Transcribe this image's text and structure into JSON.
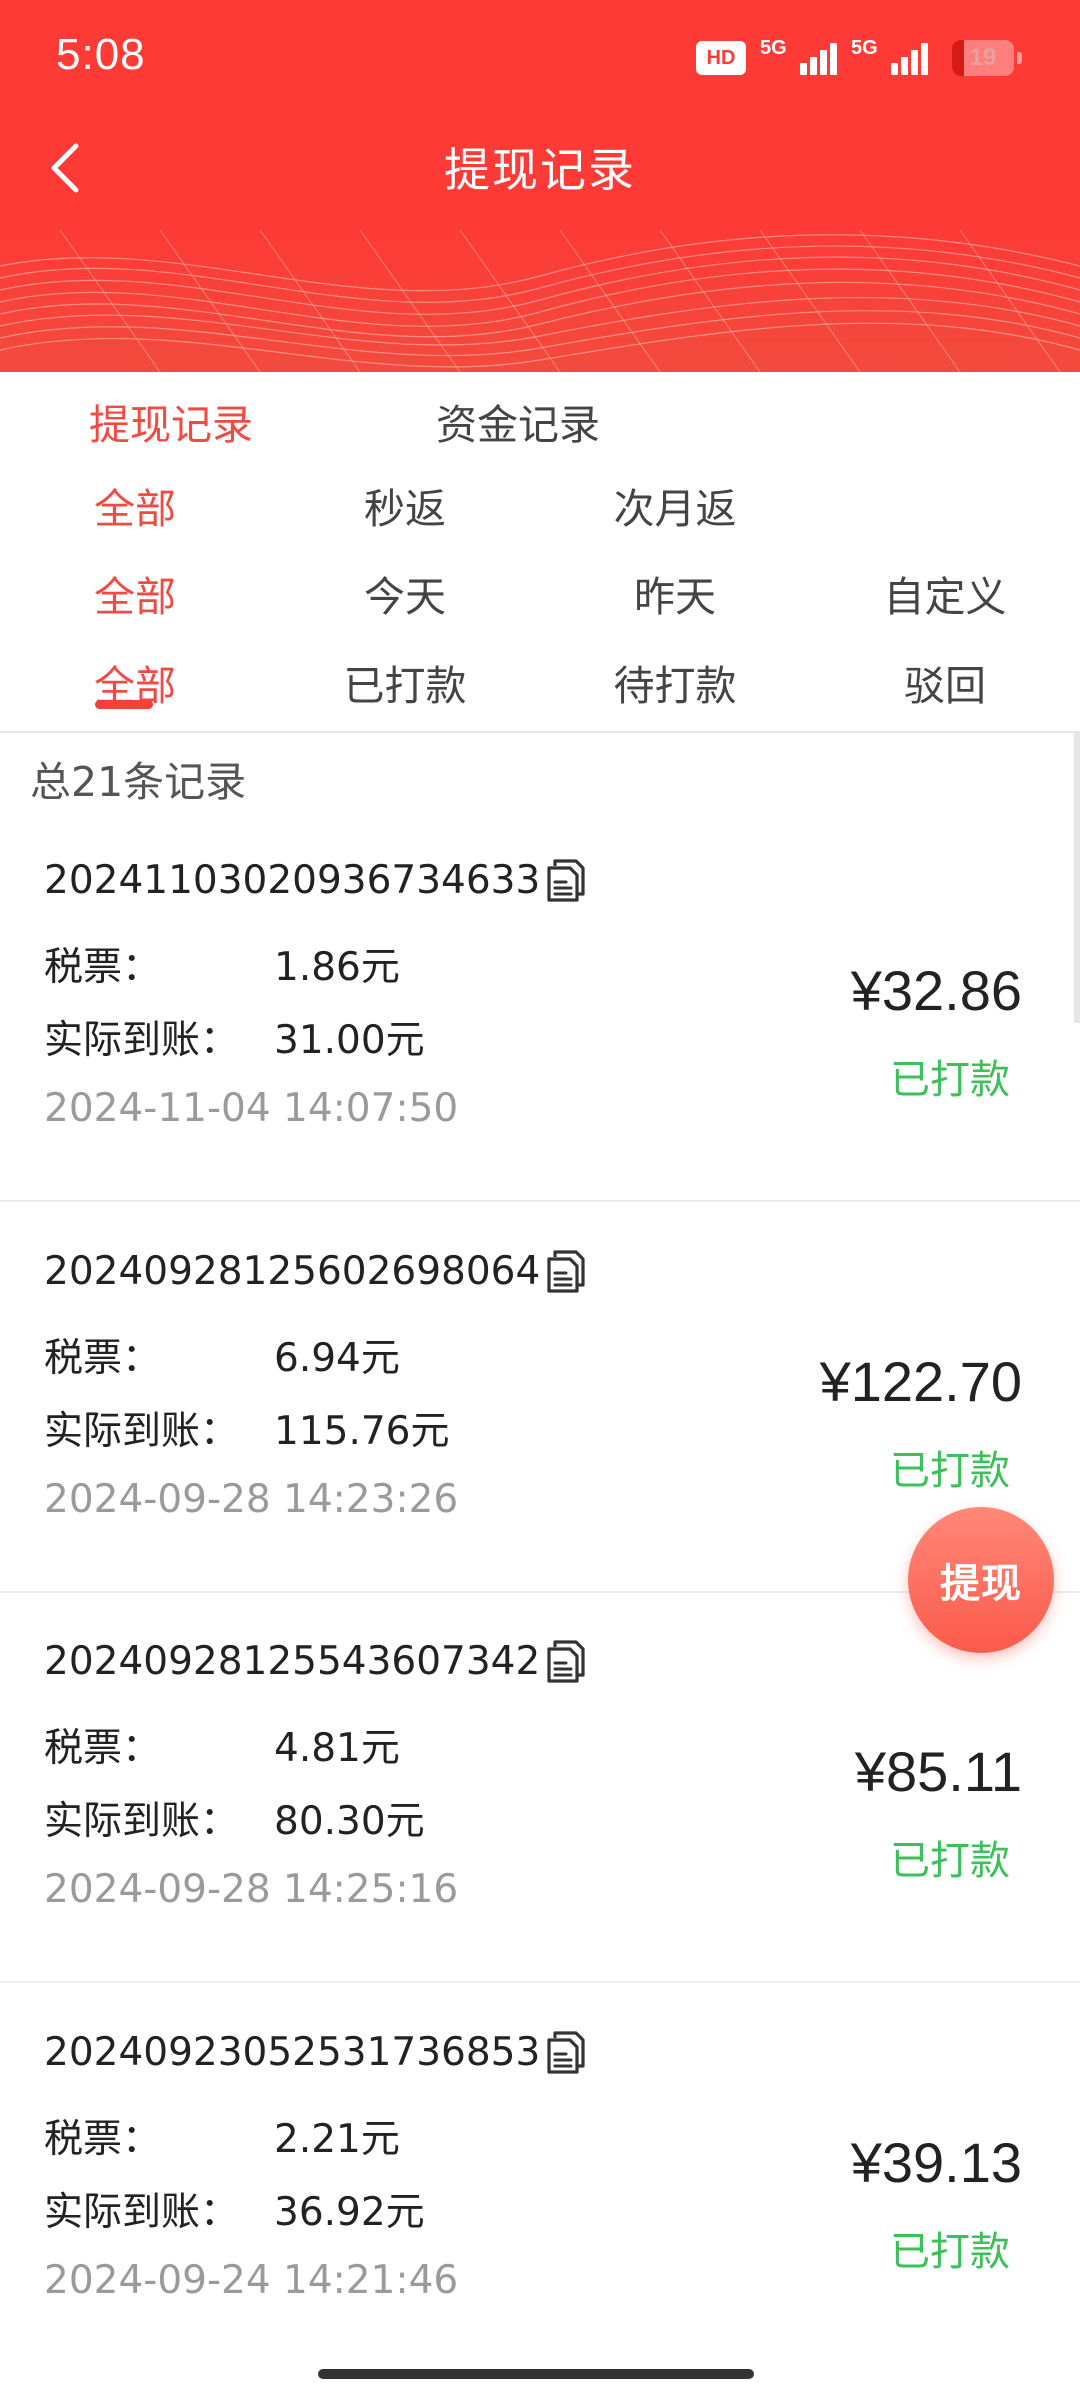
{
  "status_bar": {
    "time": "5:08",
    "hd_badge": "HD",
    "network_1": "5G",
    "network_2": "5G",
    "battery_level": "19",
    "battery_fraction": 0.19
  },
  "nav": {
    "title": "提现记录",
    "back_icon": "chevron-left-icon"
  },
  "filters": {
    "record_type": [
      {
        "label": "提现记录",
        "active": true
      },
      {
        "label": "资金记录",
        "active": false
      }
    ],
    "return_type": [
      {
        "label": "全部",
        "active": true
      },
      {
        "label": "秒返",
        "active": false
      },
      {
        "label": "次月返",
        "active": false
      }
    ],
    "time_range": [
      {
        "label": "全部",
        "active": true
      },
      {
        "label": "今天",
        "active": false
      },
      {
        "label": "昨天",
        "active": false
      },
      {
        "label": "自定义",
        "active": false
      }
    ],
    "status": [
      {
        "label": "全部",
        "active": true
      },
      {
        "label": "已打款",
        "active": false
      },
      {
        "label": "待打款",
        "active": false
      },
      {
        "label": "驳回",
        "active": false
      }
    ]
  },
  "summary": {
    "total_text": "总21条记录"
  },
  "records": [
    {
      "id": "20241103020936734633",
      "tax_label": "税票：",
      "tax": "1.86元",
      "actual_label": "实际到账：",
      "actual": "31.00元",
      "date": "2024-11-04 14:07:50",
      "amount": "¥32.86",
      "status": "已打款"
    },
    {
      "id": "20240928125602698064",
      "tax_label": "税票：",
      "tax": "6.94元",
      "actual_label": "实际到账：",
      "actual": "115.76元",
      "date": "2024-09-28 14:23:26",
      "amount": "¥122.70",
      "status": "已打款"
    },
    {
      "id": "20240928125543607342",
      "tax_label": "税票：",
      "tax": "4.81元",
      "actual_label": "实际到账：",
      "actual": "80.30元",
      "date": "2024-09-28 14:25:16",
      "amount": "¥85.11",
      "status": "已打款"
    },
    {
      "id": "20240923052531736853",
      "tax_label": "税票：",
      "tax": "2.21元",
      "actual_label": "实际到账：",
      "actual": "36.92元",
      "date": "2024-09-24 14:21:46",
      "amount": "¥39.13",
      "status": "已打款"
    }
  ],
  "fab": {
    "label": "提现"
  },
  "colors": {
    "brand_red": "#fd3a35",
    "active_tab": "#f24a42",
    "status_paid": "#3cc05a",
    "fab_gradient_top": "#ff8878",
    "fab_gradient_bottom": "#fb5a4b"
  }
}
